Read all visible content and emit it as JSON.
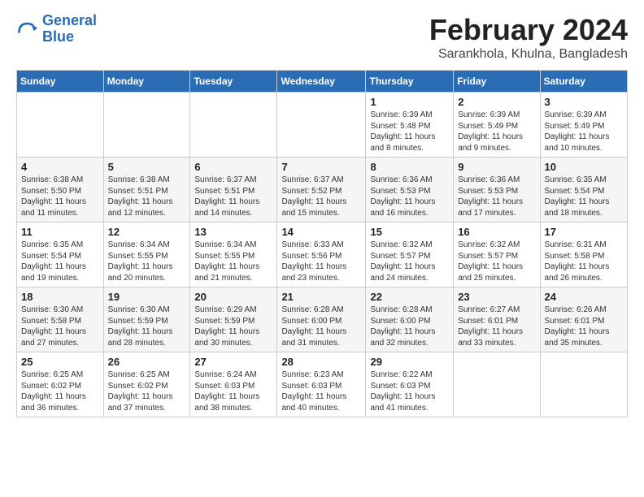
{
  "header": {
    "logo_line1": "General",
    "logo_line2": "Blue",
    "month": "February 2024",
    "location": "Sarankhola, Khulna, Bangladesh"
  },
  "days_of_week": [
    "Sunday",
    "Monday",
    "Tuesday",
    "Wednesday",
    "Thursday",
    "Friday",
    "Saturday"
  ],
  "weeks": [
    [
      {
        "day": "",
        "content": ""
      },
      {
        "day": "",
        "content": ""
      },
      {
        "day": "",
        "content": ""
      },
      {
        "day": "",
        "content": ""
      },
      {
        "day": "1",
        "content": "Sunrise: 6:39 AM\nSunset: 5:48 PM\nDaylight: 11 hours\nand 8 minutes."
      },
      {
        "day": "2",
        "content": "Sunrise: 6:39 AM\nSunset: 5:49 PM\nDaylight: 11 hours\nand 9 minutes."
      },
      {
        "day": "3",
        "content": "Sunrise: 6:39 AM\nSunset: 5:49 PM\nDaylight: 11 hours\nand 10 minutes."
      }
    ],
    [
      {
        "day": "4",
        "content": "Sunrise: 6:38 AM\nSunset: 5:50 PM\nDaylight: 11 hours\nand 11 minutes."
      },
      {
        "day": "5",
        "content": "Sunrise: 6:38 AM\nSunset: 5:51 PM\nDaylight: 11 hours\nand 12 minutes."
      },
      {
        "day": "6",
        "content": "Sunrise: 6:37 AM\nSunset: 5:51 PM\nDaylight: 11 hours\nand 14 minutes."
      },
      {
        "day": "7",
        "content": "Sunrise: 6:37 AM\nSunset: 5:52 PM\nDaylight: 11 hours\nand 15 minutes."
      },
      {
        "day": "8",
        "content": "Sunrise: 6:36 AM\nSunset: 5:53 PM\nDaylight: 11 hours\nand 16 minutes."
      },
      {
        "day": "9",
        "content": "Sunrise: 6:36 AM\nSunset: 5:53 PM\nDaylight: 11 hours\nand 17 minutes."
      },
      {
        "day": "10",
        "content": "Sunrise: 6:35 AM\nSunset: 5:54 PM\nDaylight: 11 hours\nand 18 minutes."
      }
    ],
    [
      {
        "day": "11",
        "content": "Sunrise: 6:35 AM\nSunset: 5:54 PM\nDaylight: 11 hours\nand 19 minutes."
      },
      {
        "day": "12",
        "content": "Sunrise: 6:34 AM\nSunset: 5:55 PM\nDaylight: 11 hours\nand 20 minutes."
      },
      {
        "day": "13",
        "content": "Sunrise: 6:34 AM\nSunset: 5:55 PM\nDaylight: 11 hours\nand 21 minutes."
      },
      {
        "day": "14",
        "content": "Sunrise: 6:33 AM\nSunset: 5:56 PM\nDaylight: 11 hours\nand 23 minutes."
      },
      {
        "day": "15",
        "content": "Sunrise: 6:32 AM\nSunset: 5:57 PM\nDaylight: 11 hours\nand 24 minutes."
      },
      {
        "day": "16",
        "content": "Sunrise: 6:32 AM\nSunset: 5:57 PM\nDaylight: 11 hours\nand 25 minutes."
      },
      {
        "day": "17",
        "content": "Sunrise: 6:31 AM\nSunset: 5:58 PM\nDaylight: 11 hours\nand 26 minutes."
      }
    ],
    [
      {
        "day": "18",
        "content": "Sunrise: 6:30 AM\nSunset: 5:58 PM\nDaylight: 11 hours\nand 27 minutes."
      },
      {
        "day": "19",
        "content": "Sunrise: 6:30 AM\nSunset: 5:59 PM\nDaylight: 11 hours\nand 28 minutes."
      },
      {
        "day": "20",
        "content": "Sunrise: 6:29 AM\nSunset: 5:59 PM\nDaylight: 11 hours\nand 30 minutes."
      },
      {
        "day": "21",
        "content": "Sunrise: 6:28 AM\nSunset: 6:00 PM\nDaylight: 11 hours\nand 31 minutes."
      },
      {
        "day": "22",
        "content": "Sunrise: 6:28 AM\nSunset: 6:00 PM\nDaylight: 11 hours\nand 32 minutes."
      },
      {
        "day": "23",
        "content": "Sunrise: 6:27 AM\nSunset: 6:01 PM\nDaylight: 11 hours\nand 33 minutes."
      },
      {
        "day": "24",
        "content": "Sunrise: 6:26 AM\nSunset: 6:01 PM\nDaylight: 11 hours\nand 35 minutes."
      }
    ],
    [
      {
        "day": "25",
        "content": "Sunrise: 6:25 AM\nSunset: 6:02 PM\nDaylight: 11 hours\nand 36 minutes."
      },
      {
        "day": "26",
        "content": "Sunrise: 6:25 AM\nSunset: 6:02 PM\nDaylight: 11 hours\nand 37 minutes."
      },
      {
        "day": "27",
        "content": "Sunrise: 6:24 AM\nSunset: 6:03 PM\nDaylight: 11 hours\nand 38 minutes."
      },
      {
        "day": "28",
        "content": "Sunrise: 6:23 AM\nSunset: 6:03 PM\nDaylight: 11 hours\nand 40 minutes."
      },
      {
        "day": "29",
        "content": "Sunrise: 6:22 AM\nSunset: 6:03 PM\nDaylight: 11 hours\nand 41 minutes."
      },
      {
        "day": "",
        "content": ""
      },
      {
        "day": "",
        "content": ""
      }
    ]
  ]
}
